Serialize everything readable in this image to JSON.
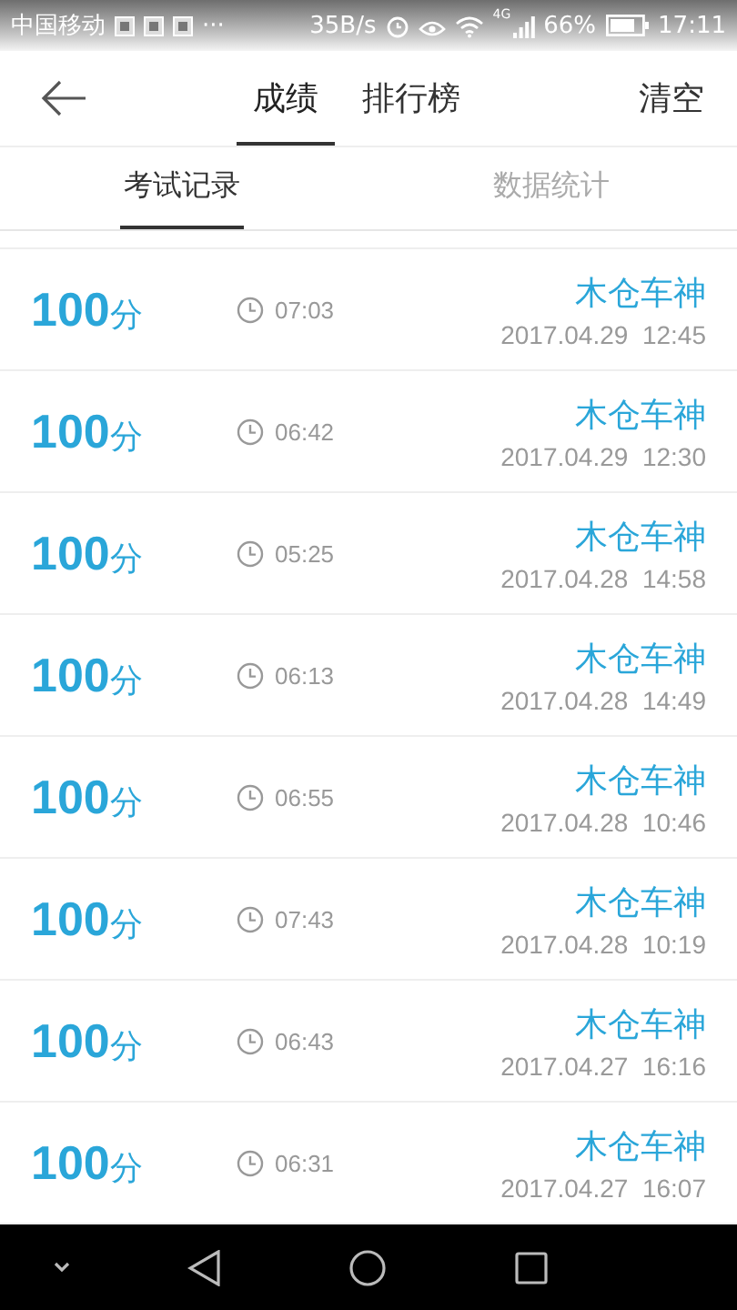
{
  "status_bar": {
    "carrier": "中国移动",
    "more": "···",
    "speed": "35B/s",
    "network": "4G",
    "battery": "66%",
    "time": "17:11"
  },
  "header": {
    "tabs": [
      {
        "label": "成绩",
        "selected": true
      },
      {
        "label": "排行榜",
        "selected": false
      }
    ],
    "action": "清空"
  },
  "sub_tabs": [
    {
      "label": "考试记录",
      "selected": true
    },
    {
      "label": "数据统计",
      "selected": false
    }
  ],
  "records": [
    {
      "score": "100",
      "unit": "分",
      "duration": "07:03",
      "name": "木仓车神",
      "date": "2017.04.29  12:45"
    },
    {
      "score": "100",
      "unit": "分",
      "duration": "06:42",
      "name": "木仓车神",
      "date": "2017.04.29  12:30"
    },
    {
      "score": "100",
      "unit": "分",
      "duration": "05:25",
      "name": "木仓车神",
      "date": "2017.04.28  14:58"
    },
    {
      "score": "100",
      "unit": "分",
      "duration": "06:13",
      "name": "木仓车神",
      "date": "2017.04.28  14:49"
    },
    {
      "score": "100",
      "unit": "分",
      "duration": "06:55",
      "name": "木仓车神",
      "date": "2017.04.28  10:46"
    },
    {
      "score": "100",
      "unit": "分",
      "duration": "07:43",
      "name": "木仓车神",
      "date": "2017.04.28  10:19"
    },
    {
      "score": "100",
      "unit": "分",
      "duration": "06:43",
      "name": "木仓车神",
      "date": "2017.04.27  16:16"
    },
    {
      "score": "100",
      "unit": "分",
      "duration": "06:31",
      "name": "木仓车神",
      "date": "2017.04.27  16:07"
    }
  ]
}
